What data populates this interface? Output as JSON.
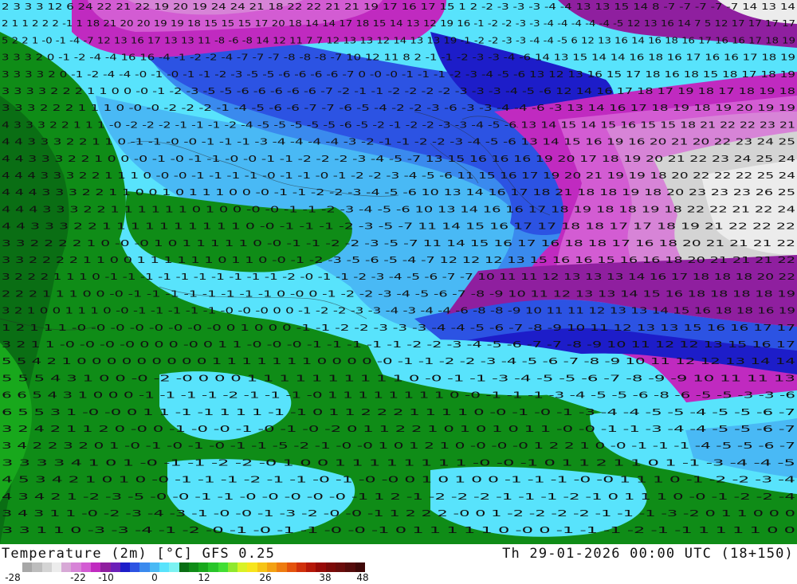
{
  "title": "Temperature (2m) [°C] GFS 0.25",
  "valid_time": "Th 29-01-2026 00:00 UTC (18+150)",
  "colorbar": {
    "labels": [
      "-28",
      "-22",
      "-10",
      "0",
      "12",
      "26",
      "38",
      "48"
    ],
    "colors": [
      "#a7a7a7",
      "#bdbdbd",
      "#d4d4d4",
      "#ececec",
      "#d7a9d6",
      "#d784d7",
      "#d35cd3",
      "#c02ac0",
      "#8f1f9f",
      "#6b1fb8",
      "#1d1dc9",
      "#2c53e3",
      "#3a8aee",
      "#49b9f5",
      "#58e3fc",
      "#7bf2f2",
      "#0a6e14",
      "#0f8c17",
      "#18a81c",
      "#28c52a",
      "#42de34",
      "#8fe82e",
      "#d9f226",
      "#f7e51d",
      "#f6c416",
      "#f3a113",
      "#ee7c10",
      "#e4530d",
      "#d0300b",
      "#b51708",
      "#970a07",
      "#7c0a08",
      "#6a0c0b",
      "#550b0b",
      "#3f0808"
    ]
  },
  "map": {
    "labels": [
      {
        "row": 0,
        "text": "2 3 3 3    12 6 24 22 21 22 19 20 19 24 24 21 18 22 22 21 21 19 17 16 17 15 1 2 -2 -3 -3 -3 -4 -4 13 13 15 14 8 -7 -7 -7 -7 -7 14 13 14"
      },
      {
        "row": 1,
        "text": "2 1 1 2 2 2 -1 1 18 21 20 20 19 19 18 15 15 15 17 20 18 14 14 17 18 15 14 13 12 19 16 -1 -2 -2 -3 -3 -4 -4 -4 -4 -4 -5 12 13 16 14 7 5 12 17 17 17 17"
      },
      {
        "row": 2,
        "text": "5 2 2 1 -0 -1 -4 -7 12 13 16 17 13 13 11 -8 -6 -8 14 12 11 7 7 12 13 13 12 14 13 13 19 -1 -2 -2 -3 -3 -4 -4 -5 6 12 13 16 14 16 18 16 17 16 16 17 18 19"
      },
      {
        "row": 3,
        "text": "3 3 3 2 0 -1 -2 -4 -4 16 16 -4 -1 -2 -2 -4 -7 -7 -7 -8 -8 -8 -7 10 12 11 8 2 -1 -1 -2 -3 -3 -4 -6 14 13 15 14 14 16 18 16 17 16 16 17 18 19"
      },
      {
        "row": 4,
        "text": "3 3 3 3 2 0 -1 -2 -4 -4 -0 -1 -0 -1 -1 -2 -3 -5 -5 -6 -6 -6 -6 -7 0 -0 -0 -1 -1 -1 -2 -3 -4 -5 -6 13 12 13 16 15 17 18 16 18 15 18 17 18 19"
      },
      {
        "row": 5,
        "text": "3 3 3 3 2 2 2 1 1 0 0 -0 -1 -2 -3 -5 -5 -6 -6 -6 -6 -6 -7 -2 -1 -1 -2 -2 -2 -2 -3 -3 -3 -4 -5 -6 12 14 16 17 18 17 19 18 17 18 19 18"
      },
      {
        "row": 6,
        "text": "3 3 3 2 2 2 1 1 1 0 -0 -0 -2 -2 -2 -1 -4 -5 -6 -6 -7 -7 -6 -5 -4 -2 -2 -3 -6 -3 -3 -4 -4 -6 -3 13 14 16 17 18 19 18 19 20 19 19"
      },
      {
        "row": 7,
        "text": "4 3 3 3 2 2 1 1 1 -0 -2 -2 -2 -1 -1 -1 -2 -4 -5 -5 -5 -5 -5 -6 -5 -2 -1 -2 -2 -3 -3 -4 -5 -6 13 14 15 14 15 16 15 15 18 21 22 22 23 21"
      },
      {
        "row": 8,
        "text": "4 4 3 3 3 2 2 1 1 0 -1 -1 -0 -0 -1 -1 -1 -3 -4 -4 -4 -4 -3 -2 -1 -1 -2 -2 -3 -4 -5 -6 13 14 15 16 19 16 20 21 20 22 23 24 25"
      },
      {
        "row": 9,
        "text": "4 4 3 3 3 2 2 1 0 0 -0 -1 -0 -1 -1 -0 -0 -1 -1 -2 -2 -2 -3 -4 -5 -7 13 15 16 16 16 19 20 17 18 19 20 21 22 23 24 25 24"
      },
      {
        "row": 10,
        "text": "4 4 4 3 3 3 2 2 1 1 1 0 -0 -0 -1 -1 -1 -1 -0 -1 -1 -0 -1 -2 -2 -3 -4 -5 -6 11 15 16 17 19 20 21 19 19 18 20 22 22 22 25 24"
      },
      {
        "row": 11,
        "text": "4 4 4 3 3 3 2 2 1 1 0 0 1 0 1 1 1 0 0 -0 -1 -1 -2 -2 -3 -4 -5 -6 10 13 14 16 17 18 21 18 18 19 18 20 23 23 23 26 25"
      },
      {
        "row": 12,
        "text": "4 4 4 3 3 3 2 2 1 1 1 1 1 1 0 1 0 0 -0 -0 -1 -1 -2 -3 -4 -5 -6 10 13 14 16 16 17 18 19 18 18 19 18 22 22 21 22 24"
      },
      {
        "row": 13,
        "text": "4 4 3 3 3 2 2 1 1 1 1 1 1 1 1 1 1 0 -0 -1 -1 -1 -2 -3 -5 -7 11 14 15 16 17 17 18 18 17 17 18 19 21 22 22 22"
      },
      {
        "row": 14,
        "text": "3 3 2 2 2 2 1 0 -0 -0 1 0 1 1 1 1 1 0 -0 -1 -1 -2 -2 -3 -5 -7 11 14 15 16 17 16 18 18 17 16 18 20 21 21 21 22"
      },
      {
        "row": 15,
        "text": "3 3 2 2 2 2 1 1 0 0 1 1 1 1 1 1 0 1 1 0 -0 -1 -2 -3 -5 -6 -5 -4 -7 12 12 12 13 15 16 16 15 16 16 18 20 21 21 21 22"
      },
      {
        "row": 16,
        "text": "3 2 2 2 1 1 1 0 -1 -1 -1 -1 -1 -1 -1 -1 -1 -1 -2 -0 -1 -1 -2 -3 -4 -5 -6 -7 -7 10 11 11 12 13 13 13 14 16 17 18 18 18 20 22"
      },
      {
        "row": 17,
        "text": "2 2 2 1 1 1 0 0 -0 -1 -1 -1 -1 -1 -1 -1 -1 0 -0 0 -1 -2 -2 -3 -4 -5 -6 -7 -8 -9 10 11 12 13 13 14 15 16 18 18 18 18 19"
      },
      {
        "row": 18,
        "text": "3 2 1 0 0 1 1 1 0 -0 -1 -1 -1 -1 -1 -0 -0 -0 0 0 -1 -2 -2 -3 -3 -4 -3 -4 -4 -6 -8 -8 -9 10 11 11 12 13 13 14 15 16 18 18 16 19"
      },
      {
        "row": 19,
        "text": "1 2 1 1 1 -0 -0 -0 -0 -0 -0 -0 -0 0 1 0 0 0 -1 -1 -2 -2 -3 -3 -3 -4 -4 -5 -6 -7 -8 -9 10 11 12 13 13 15 16 16 17 17"
      },
      {
        "row": 20,
        "text": "3 2 1 1 -0 -0 -0 -0 0 0 0 -0 0 1 1 -0 -0 -0 -1 -1 -1 -1 -1 -2 -2 -3 -4 -5 -6 -7 -7 -8 -9 10 11 12 12 13 15 16 17"
      },
      {
        "row": 21,
        "text": "5 5 4 2 1 0 0 0 0 0 0 0 0 0 1 1 1 1 1 1 1 0 0 0 0 -0 -1 -1 -2 -2 -3 -4 -5 -6 -7 -8 -9 10 11 12 12 13 14 14"
      },
      {
        "row": 22,
        "text": "5 5 5 4 3 1 0 0 -0 -2 -0 0 0 0 1 1 1 1 1 1 1 1 1 1 0 -0 -1 -1 -3 -4 -5 -5 -6 -7 -8 -9 -9 10 11 11 13"
      },
      {
        "row": 23,
        "text": "6 6 5 4 3 1 0 0 0 -1 -1 -1 -1 -2 -1 -1 -1 -0 1 1 1 1 1 1 1 1 0 -0 -1 -1 -1 -3 -4 -5 -5 -6 -8 -6 -5 -5 -3 -3 -6"
      },
      {
        "row": 24,
        "text": "6 5 5 3 1 -0 -0 0 1 1 -1 -1 1 1 1 -1 -1 0 1 1 2 2 2 1 1 1 1 0 -0 -1 -0 -1 -3 -4 -4 -5 -5 -4 -5 -5 -6 -7"
      },
      {
        "row": 25,
        "text": "3 2 4 2 1 1 2 0 -0 0 -1 -0 -0 -1 -0 -1 -0 -2 0 1 1 2 2 1 0 1 0 1 0 1 1 -0 -0 -1 -1 -3 -4 -4 -5 -5 -6 -7"
      },
      {
        "row": 26,
        "text": "3 4 2 2 3 2 0 1 -0 -1 -0 -1 -0 -1 -1 -5 -2 -1 -0 -0 1 0 1 2 1 0 -0 -0 -0 1 2 2 1 0 -0 -1 -1 -1 -4 -5 -5 -6 -7"
      },
      {
        "row": 27,
        "text": "3 3 3 3 4 1 0 1 -0 -1 -1 -2 -2 -0 1 0 0 1 1 1 1 1 1 1 1 -0 -0 -1 0 1 1 2 1 1 0 1 -1 -3 -4 -4 -5"
      },
      {
        "row": 28,
        "text": "4 5 3 4 2 1 0 1 0 -0 -1 -1 -1 -2 -1 -1 -0 -1 -0 -0 0 1 0 1 0 0 -1 -1 -1 -0 -0 1 1 1 0 -1 -2 -2 -3 -4"
      },
      {
        "row": 29,
        "text": "4 3 4 2 1 -2 -3 -5 -0 -0 -1 -1 -0 -0 -0 -0 -0 -1 1 2 -1 -2 -2 -2 -1 -1 -1 -2 -1 0 1 1 1 0 -0 -1 -2 -2 -4"
      },
      {
        "row": 30,
        "text": "3 4 3 1 1 -0 -2 -3 -4 -3 -1 -0 -0 -1 -3 -2 -0 -0 -1 1 2 2 2 -0 0 1 -2 -2 -2 -2 -1 -1 -1 -3 -2 0 1 1 0 0 0"
      },
      {
        "row": 31,
        "text": "3 3 1 1 0 -3 -3 -4 -1 -2 -0 -1 -0 -1 -1 -0 -0 -1 0 1 1 1 1 1 0 -0 0 -1 -1 -1 -2 -1 -1 1 1 1 1 0 0"
      }
    ]
  }
}
